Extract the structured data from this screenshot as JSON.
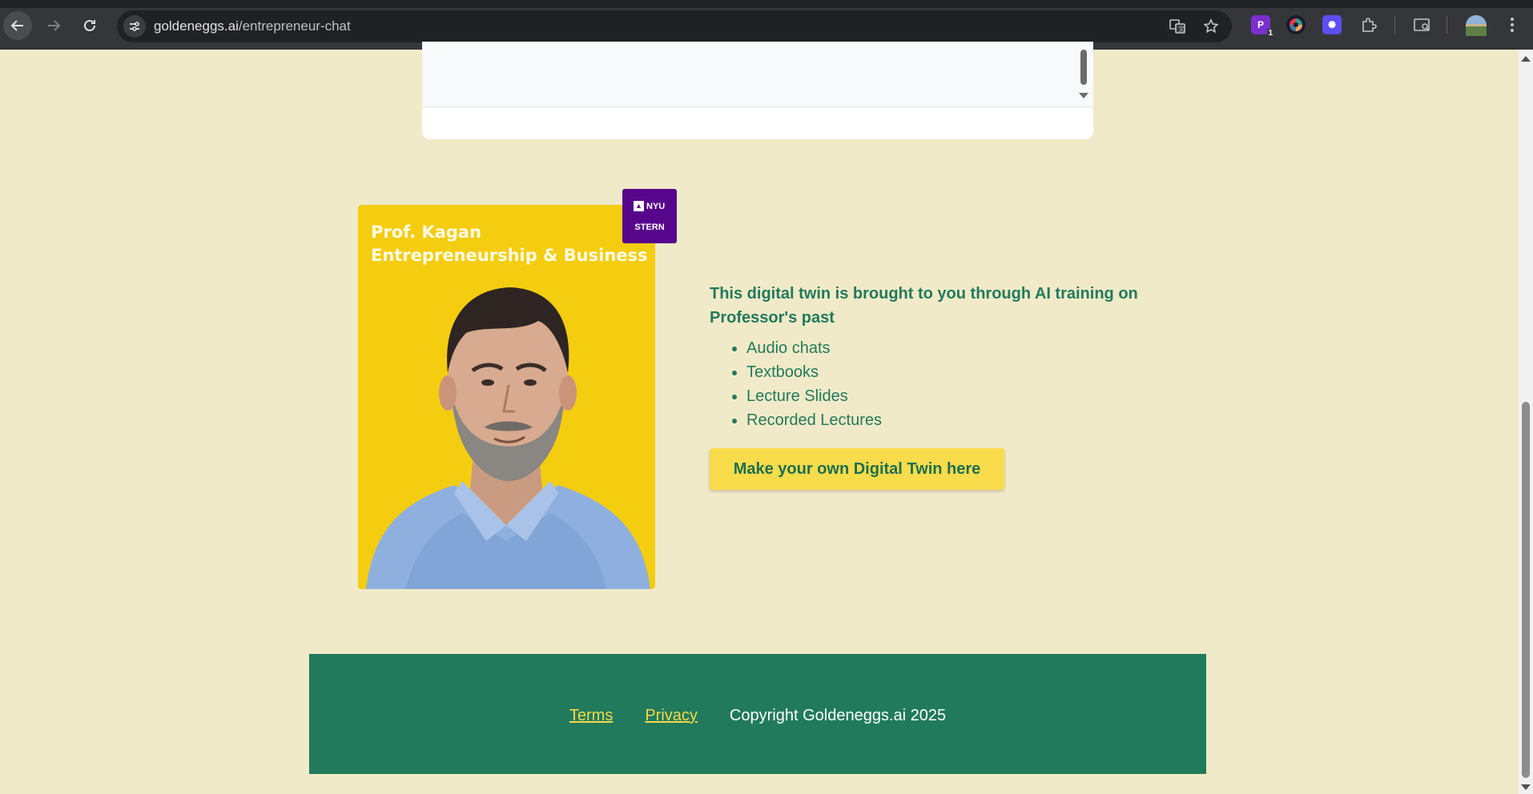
{
  "browser": {
    "url_domain": "goldeneggs.ai",
    "url_path": "/entrepreneur-chat",
    "extensions": [
      {
        "name": "p-extension-icon",
        "label": "P",
        "badge": "1",
        "color": "#7b2fd0"
      },
      {
        "name": "color-wheel-extension-icon",
        "label": "",
        "color": "#1a1a2e"
      },
      {
        "name": "flower-extension-icon",
        "label": "",
        "color": "#5b4ff2"
      }
    ]
  },
  "profile_card": {
    "name": "Prof. Kagan",
    "subject": "Entrepreneurship & Business",
    "badge_line1": "NYU",
    "badge_line2": "STERN"
  },
  "info": {
    "headline": "This digital twin is brought to you through AI training on Professor's past",
    "sources": [
      "Audio chats",
      "Textbooks",
      "Lecture Slides",
      "Recorded Lectures"
    ],
    "cta_label": "Make your own Digital Twin here"
  },
  "footer": {
    "terms": "Terms",
    "privacy": "Privacy",
    "copyright": "Copyright Goldeneggs.ai 2025"
  },
  "colors": {
    "page_bg": "#f1eac8",
    "brand_green": "#217a5c",
    "brand_yellow": "#f4cd10",
    "nyu_purple": "#57068c"
  }
}
